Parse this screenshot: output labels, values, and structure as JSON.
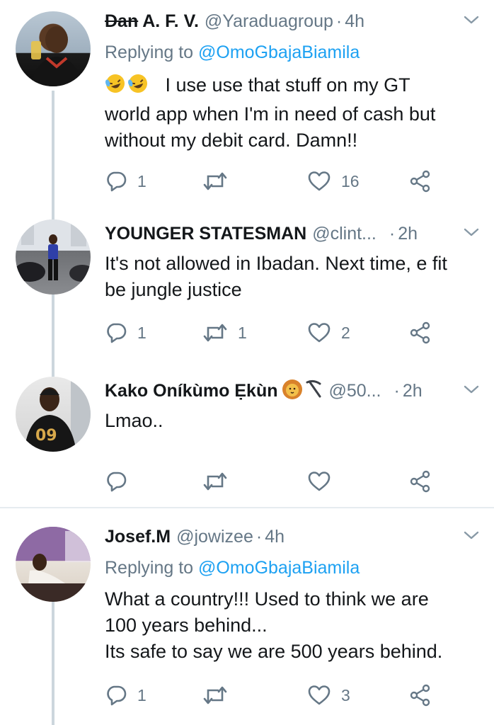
{
  "tweets": [
    {
      "name_strike": "Dan",
      "name": "A. F. V.",
      "handle": "@Yaraduagroup",
      "sep": "·",
      "time": "4h",
      "replying_label": "Replying to",
      "replying_mention": "@OmoGbajaBiamila",
      "text_line1": "I use use that stuff on my GT",
      "text_line2": "world app when I'm in need of cash but",
      "text_line3": "without my debit card. Damn!!",
      "replies": "1",
      "retweets": "",
      "likes": "16"
    },
    {
      "name": "YOUNGER STATESMAN",
      "handle": "@clint...",
      "sep": "·",
      "time": "2h",
      "text_line1": "It's not allowed in Ibadan. Next time, e fit",
      "text_line2": "be jungle justice",
      "replies": "1",
      "retweets": "1",
      "likes": "2"
    },
    {
      "name": "Kako Oníkùmo Ẹkùn",
      "handle": "@50...",
      "sep": "·",
      "time": "2h",
      "text_line1": "Lmao..",
      "replies": "",
      "retweets": "",
      "likes": ""
    },
    {
      "name": "Josef.M",
      "handle": "@jowizee",
      "sep": "·",
      "time": "4h",
      "replying_label": "Replying to",
      "replying_mention": "@OmoGbajaBiamila",
      "text_line1": "What a country!!! Used to think we are",
      "text_line2": "100 years behind...",
      "text_line3": "Its safe to say we are 500 years behind.",
      "replies": "1",
      "retweets": "",
      "likes": "3"
    }
  ],
  "icons": {
    "reply": "reply-icon",
    "retweet": "retweet-icon",
    "like": "heart-icon",
    "share": "share-icon",
    "menu": "chevron-down-icon"
  },
  "colors": {
    "text": "#14171a",
    "muted": "#657786",
    "link": "#1da1f2",
    "thread_line": "#ccd6dd",
    "divider": "#e6ecf0"
  }
}
